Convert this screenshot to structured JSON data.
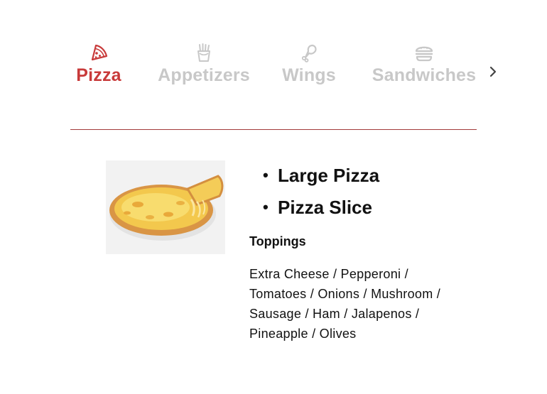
{
  "tabs": [
    {
      "label": "Pizza",
      "icon": "pizza-slice-icon",
      "active": true
    },
    {
      "label": "Appetizers",
      "icon": "fries-icon",
      "active": false
    },
    {
      "label": "Wings",
      "icon": "chicken-leg-icon",
      "active": false
    },
    {
      "label": "Sandwiches",
      "icon": "burger-icon",
      "active": false
    }
  ],
  "next_icon": "chevron-right-icon",
  "colors": {
    "accent": "#c83a3a",
    "inactive_tab": "#c8c8c8",
    "divider": "#a23b3b",
    "text": "#111111"
  },
  "menu": {
    "image": "cheese-pizza-image",
    "items": [
      "Large Pizza",
      "Pizza Slice"
    ],
    "toppings_title": "Toppings",
    "toppings_text": "Extra Cheese / Pepperoni / Tomatoes / Onions / Mushroom / Sausage / Ham / Jalapenos / Pineapple / Olives"
  }
}
